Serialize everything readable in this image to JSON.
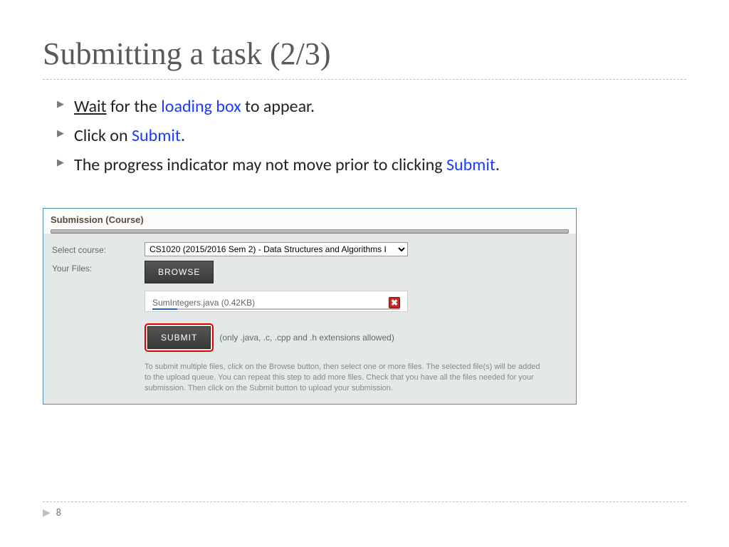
{
  "title": "Submitting a task (2/3)",
  "bullets": {
    "b1": {
      "wait": "Wait",
      "mid": " for the ",
      "loading": "loading box",
      "tail": " to appear."
    },
    "b2": {
      "pre": "Click on ",
      "submit": "Submit",
      "post": "."
    },
    "b3": {
      "pre": "The progress indicator may not move prior to clicking ",
      "submit": "Submit",
      "post": "."
    }
  },
  "panel": {
    "header": "Submission (Course)",
    "labels": {
      "select_course": "Select course:",
      "your_files": "Your Files:"
    },
    "course_option": "CS1020 (2015/2016 Sem 2) - Data Structures and Algorithms I",
    "browse": "BROWSE",
    "file": "SumIntegers.java (0.42KB)",
    "submit": "SUBMIT",
    "hint": "(only .java, .c, .cpp and .h extensions allowed)",
    "help": "To submit multiple files, click on the Browse button, then select one or more files. The selected file(s) will be added to the upload queue. You can repeat this step to add more files. Check that you have all the files needed for your submission. Then click on the Submit button to upload your submission."
  },
  "page_number": "8"
}
